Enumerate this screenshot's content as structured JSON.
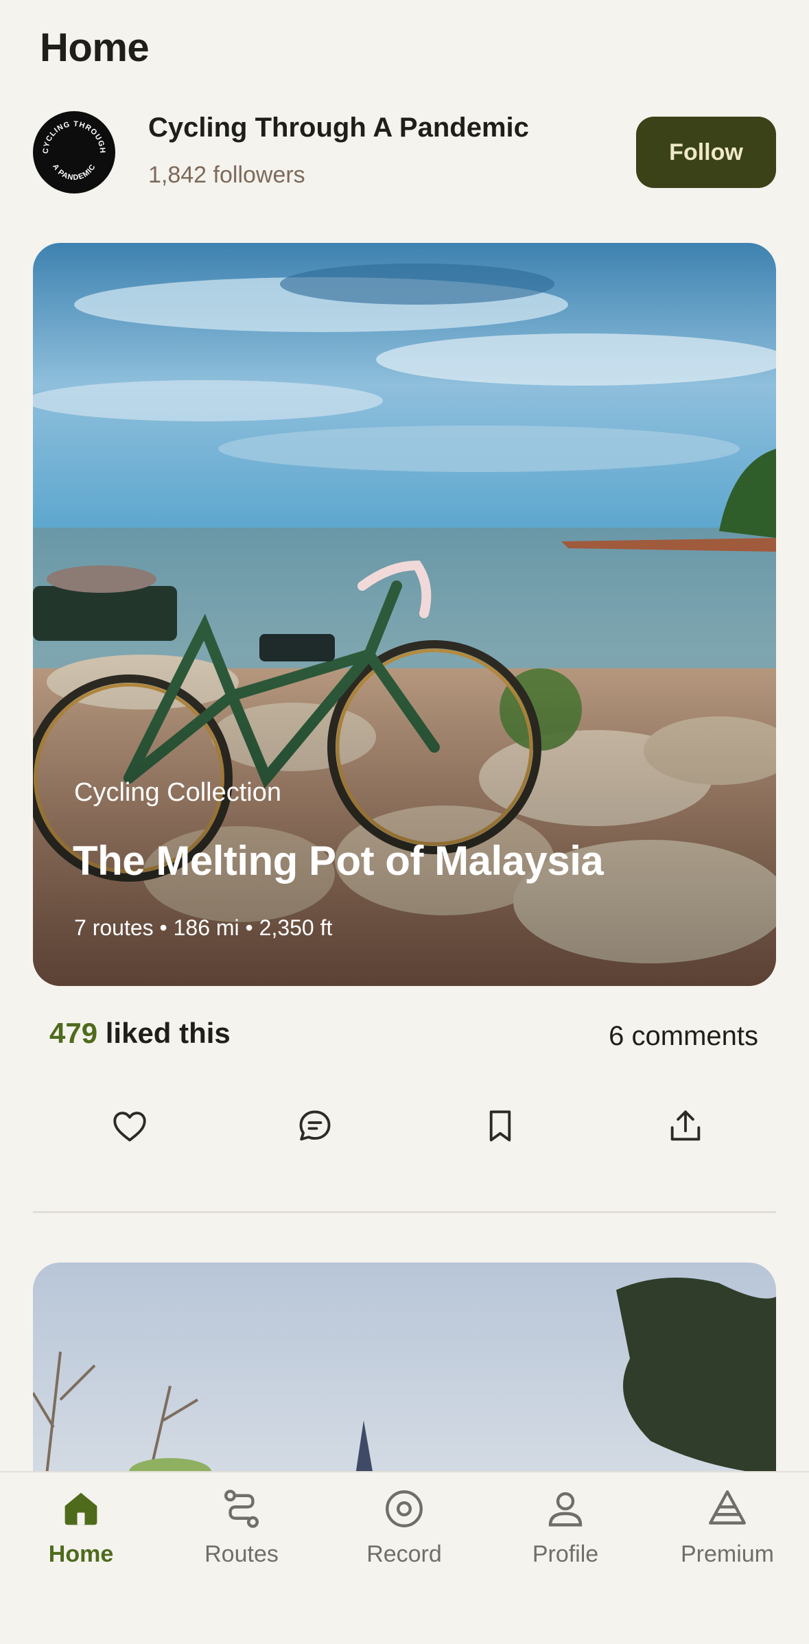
{
  "header": {
    "title": "Home"
  },
  "channel": {
    "avatar_text_top": "CYCLING THROUGH",
    "avatar_text_bottom": "A PANDEMIC",
    "name": "Cycling Through A Pandemic",
    "followers": "1,842 followers",
    "follow_label": "Follow"
  },
  "collection": {
    "label": "Cycling Collection",
    "title": "The Melting Pot of Malaysia",
    "stats": "7 routes • 186 mi • 2,350 ft"
  },
  "engagement": {
    "likes_count": "479",
    "likes_suffix": " liked this",
    "comments": "6 comments"
  },
  "actions": [
    {
      "name": "like",
      "icon": "heart-icon"
    },
    {
      "name": "comment",
      "icon": "chat-bubble-icon"
    },
    {
      "name": "save",
      "icon": "bookmark-icon"
    },
    {
      "name": "share",
      "icon": "share-upload-icon"
    }
  ],
  "nav": {
    "items": [
      {
        "label": "Home",
        "icon": "home-icon",
        "active": true
      },
      {
        "label": "Routes",
        "icon": "route-icon",
        "active": false
      },
      {
        "label": "Record",
        "icon": "record-icon",
        "active": false
      },
      {
        "label": "Profile",
        "icon": "profile-icon",
        "active": false
      },
      {
        "label": "Premium",
        "icon": "premium-icon",
        "active": false
      }
    ]
  },
  "colors": {
    "background": "#f5f3ee",
    "accent": "#4e6b1c",
    "follow_button": "#3b4218",
    "follower_text": "#7c6a5a"
  }
}
